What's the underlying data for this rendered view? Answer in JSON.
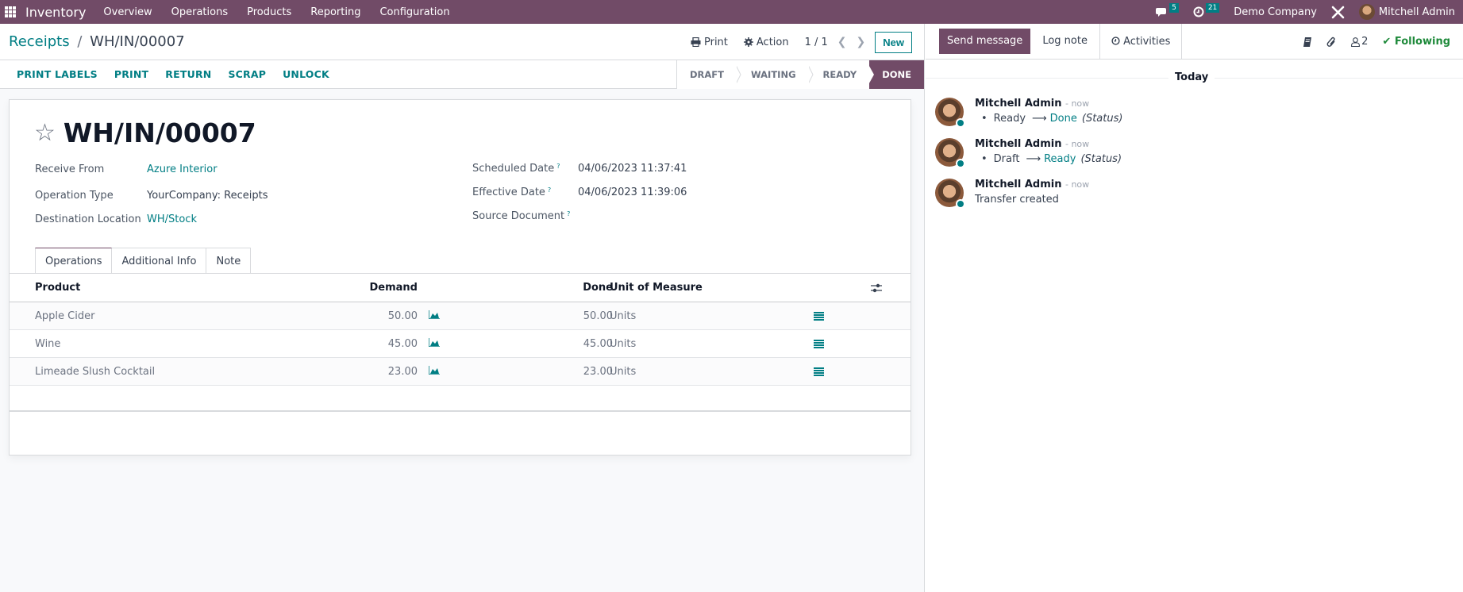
{
  "navbar": {
    "app_name": "Inventory",
    "menu": [
      "Overview",
      "Operations",
      "Products",
      "Reporting",
      "Configuration"
    ],
    "messages_count": "5",
    "activities_count": "21",
    "company": "Demo Company",
    "user": "Mitchell Admin"
  },
  "control_panel": {
    "breadcrumb_parent": "Receipts",
    "breadcrumb_separator": "/",
    "breadcrumb_current": "WH/IN/00007",
    "print_label": "Print",
    "action_label": "Action",
    "pager": "1 / 1",
    "new_label": "New",
    "actions": [
      "PRINT LABELS",
      "PRINT",
      "RETURN",
      "SCRAP",
      "UNLOCK"
    ],
    "stages": [
      "DRAFT",
      "WAITING",
      "READY",
      "DONE"
    ],
    "active_stage": "DONE"
  },
  "record": {
    "title": "WH/IN/00007",
    "left_fields": [
      {
        "label": "Receive From",
        "value": "Azure Interior",
        "link": true
      },
      {
        "label": "Operation Type",
        "value": "YourCompany: Receipts",
        "link": false
      },
      {
        "label": "Destination Location",
        "value": "WH/Stock",
        "link": true
      }
    ],
    "right_fields": [
      {
        "label": "Scheduled Date",
        "help": "?",
        "value": "04/06/2023 11:37:41"
      },
      {
        "label": "Effective Date",
        "help": "?",
        "value": "04/06/2023 11:39:06"
      },
      {
        "label": "Source Document",
        "help": "?",
        "value": ""
      }
    ],
    "tabs": [
      "Operations",
      "Additional Info",
      "Note"
    ],
    "active_tab": "Operations"
  },
  "operations_table": {
    "columns": {
      "product": "Product",
      "demand": "Demand",
      "done": "Done",
      "uom": "Unit of Measure"
    },
    "rows": [
      {
        "product": "Apple Cider",
        "demand": "50.00",
        "done": "50.00",
        "uom": "Units"
      },
      {
        "product": "Wine",
        "demand": "45.00",
        "done": "45.00",
        "uom": "Units"
      },
      {
        "product": "Limeade Slush Cocktail",
        "demand": "23.00",
        "done": "23.00",
        "uom": "Units"
      }
    ]
  },
  "chatter": {
    "send_message_label": "Send message",
    "log_note_label": "Log note",
    "activities_label": "Activities",
    "followers_count": "2",
    "following_label": "Following",
    "date_separator": "Today",
    "messages": [
      {
        "author": "Mitchell Admin",
        "date": "- now",
        "type": "tracking",
        "old": "Ready",
        "new": "Done",
        "field": "(Status)"
      },
      {
        "author": "Mitchell Admin",
        "date": "- now",
        "type": "tracking",
        "old": "Draft",
        "new": "Ready",
        "field": "(Status)"
      },
      {
        "author": "Mitchell Admin",
        "date": "- now",
        "type": "text",
        "body": "Transfer created"
      }
    ]
  },
  "colors": {
    "brand": "#714b67",
    "accent": "#017e84",
    "following": "#1f8a3b"
  }
}
